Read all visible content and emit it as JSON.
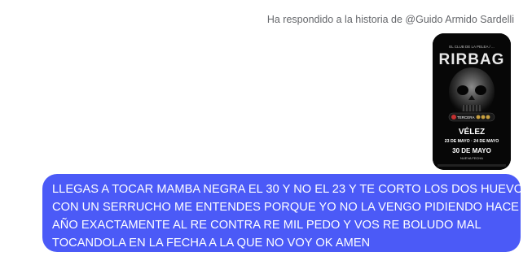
{
  "reply_note": "Ha respondido a la historia de @Guido Armido Sardelli",
  "story": {
    "poster_top": "EL CLUB DE LA PELEA / ...",
    "band": "RIRBAG",
    "tour": "TERCERA",
    "venue": "VÉLEZ",
    "dates": "23 DE MAYO · 24 DE MAYO",
    "extra_date": "30 DE MAYO",
    "extra_label": "NUEVA FECHA"
  },
  "message": {
    "lines": [
      "LLEGAS A TOCAR MAMBA NEGRA EL 30 Y NO EL 23 Y TE CORTO LOS DOS HUEVOS",
      "CON UN SERRUCHO ME ENTENDES PORQUE YO NO LA VENGO PIDIENDO HACE UN",
      "AÑO EXACTAMENTE AL RE CONTRA RE MIL PEDO Y VOS RE BOLUDO MAL",
      "TOCANDOLA EN LA FECHA A LA QUE NO VOY OK AMEN"
    ],
    "bubble_color": "#4b5af7"
  }
}
